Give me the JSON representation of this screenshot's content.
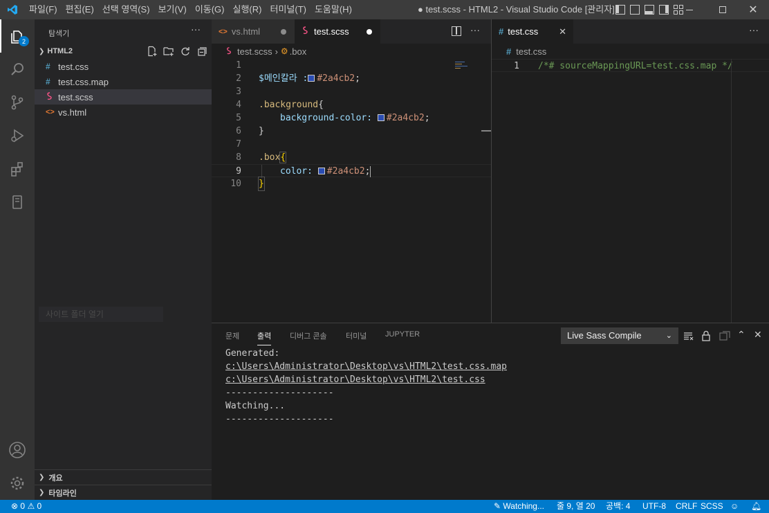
{
  "titlebar": {
    "menu": [
      "파일(F)",
      "편집(E)",
      "선택 영역(S)",
      "보기(V)",
      "이동(G)",
      "실행(R)",
      "터미널(T)",
      "도움말(H)"
    ],
    "title": "● test.scss - HTML2 - Visual Studio Code [관리자]"
  },
  "activity": {
    "explorer_badge": "2"
  },
  "sidebar": {
    "title": "탐색기",
    "more": "···",
    "project": "HTML2",
    "files": [
      {
        "name": "test.css",
        "icon": "#"
      },
      {
        "name": "test.css.map",
        "icon": "#"
      },
      {
        "name": "test.scss",
        "icon": "scss"
      },
      {
        "name": "vs.html",
        "icon": "<>"
      }
    ],
    "drag_ghost": "사이트 폴더 열기",
    "sections": [
      "개요",
      "타임라인"
    ]
  },
  "editor1": {
    "tabs": [
      {
        "label": "vs.html",
        "icon": "<>"
      },
      {
        "label": "test.scss",
        "icon": "scss"
      }
    ],
    "breadcrumb": {
      "file": "test.scss",
      "symbol": ".box"
    },
    "lines": {
      "l2_var": "$메인칼라 :",
      "l2_val": "#2a4cb2",
      "l2_end": ";",
      "l4_sel": ".background",
      "l4_brace": "{",
      "l5_prop": "background-color:",
      "l5_val": "#2a4cb2",
      "l5_end": ";",
      "l6": "}",
      "l8_sel": ".box",
      "l8_brace": "{",
      "l9_prop": "color:",
      "l9_val": "#2a4cb2",
      "l9_end": ";",
      "l10": "}"
    }
  },
  "editor2": {
    "tab": "test.css",
    "breadcrumb": "test.css",
    "line1": "/*# sourceMappingURL=test.css.map */"
  },
  "panel": {
    "tabs": [
      "문제",
      "출력",
      "디버그 콘솔",
      "터미널",
      "JUPYTER"
    ],
    "selected_tab": "출력",
    "output_channel": "Live Sass Compile",
    "output": [
      "Generated:",
      "c:\\Users\\Administrator\\Desktop\\vs\\HTML2\\test.css.map",
      "c:\\Users\\Administrator\\Desktop\\vs\\HTML2\\test.css",
      "--------------------",
      "Watching...",
      "--------------------"
    ]
  },
  "status": {
    "errors": "0",
    "warnings": "0",
    "watching": "Watching...",
    "position": "줄 9, 열 20",
    "spaces": "공백: 4",
    "encoding": "UTF-8",
    "eol": "CRLF",
    "language": "SCSS"
  },
  "colors": {
    "accent": "#007acc",
    "swatch": "#2a4cb2"
  }
}
